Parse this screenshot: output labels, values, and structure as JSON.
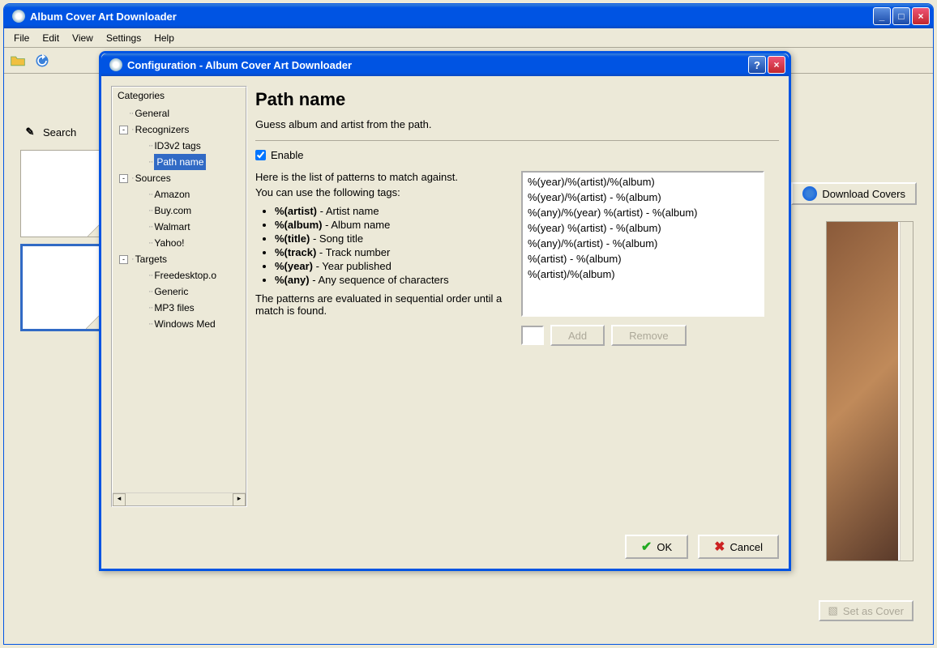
{
  "main": {
    "title": "Album Cover Art Downloader",
    "menu": [
      "File",
      "Edit",
      "View",
      "Settings",
      "Help"
    ],
    "search_label": "Search",
    "download_btn": "Download Covers",
    "set_cover_btn": "Set as Cover"
  },
  "dialog": {
    "title": "Configuration - Album Cover Art Downloader",
    "tree_label": "Categories",
    "tree": {
      "general": "General",
      "recognizers": "Recognizers",
      "id3v2": "ID3v2 tags",
      "pathname": "Path name",
      "sources": "Sources",
      "amazon": "Amazon",
      "buycom": "Buy.com",
      "walmart": "Walmart",
      "yahoo": "Yahoo!",
      "targets": "Targets",
      "freedesktop": "Freedesktop.o",
      "generic": "Generic",
      "mp3": "MP3 files",
      "winmedia": "Windows Med"
    },
    "panel": {
      "title": "Path name",
      "subtitle": "Guess album and artist from the path.",
      "enable": "Enable",
      "intro1": "Here is the list of patterns to match against.",
      "intro2": "You can use the following tags:",
      "tags": [
        {
          "k": "%(artist)",
          "d": " - Artist name"
        },
        {
          "k": "%(album)",
          "d": " - Album name"
        },
        {
          "k": "%(title)",
          "d": " - Song title"
        },
        {
          "k": "%(track)",
          "d": " - Track number"
        },
        {
          "k": "%(year)",
          "d": " - Year published"
        },
        {
          "k": "%(any)",
          "d": " - Any sequence of characters"
        }
      ],
      "note": "The patterns are evaluated in sequential order until a match is found.",
      "patterns": [
        "%(year)/%(artist)/%(album)",
        "%(year)/%(artist) - %(album)",
        "%(any)/%(year) %(artist) - %(album)",
        "%(year) %(artist) - %(album)",
        "%(any)/%(artist) - %(album)",
        "%(artist) - %(album)",
        "%(artist)/%(album)"
      ],
      "add": "Add",
      "remove": "Remove"
    },
    "ok": "OK",
    "cancel": "Cancel"
  }
}
